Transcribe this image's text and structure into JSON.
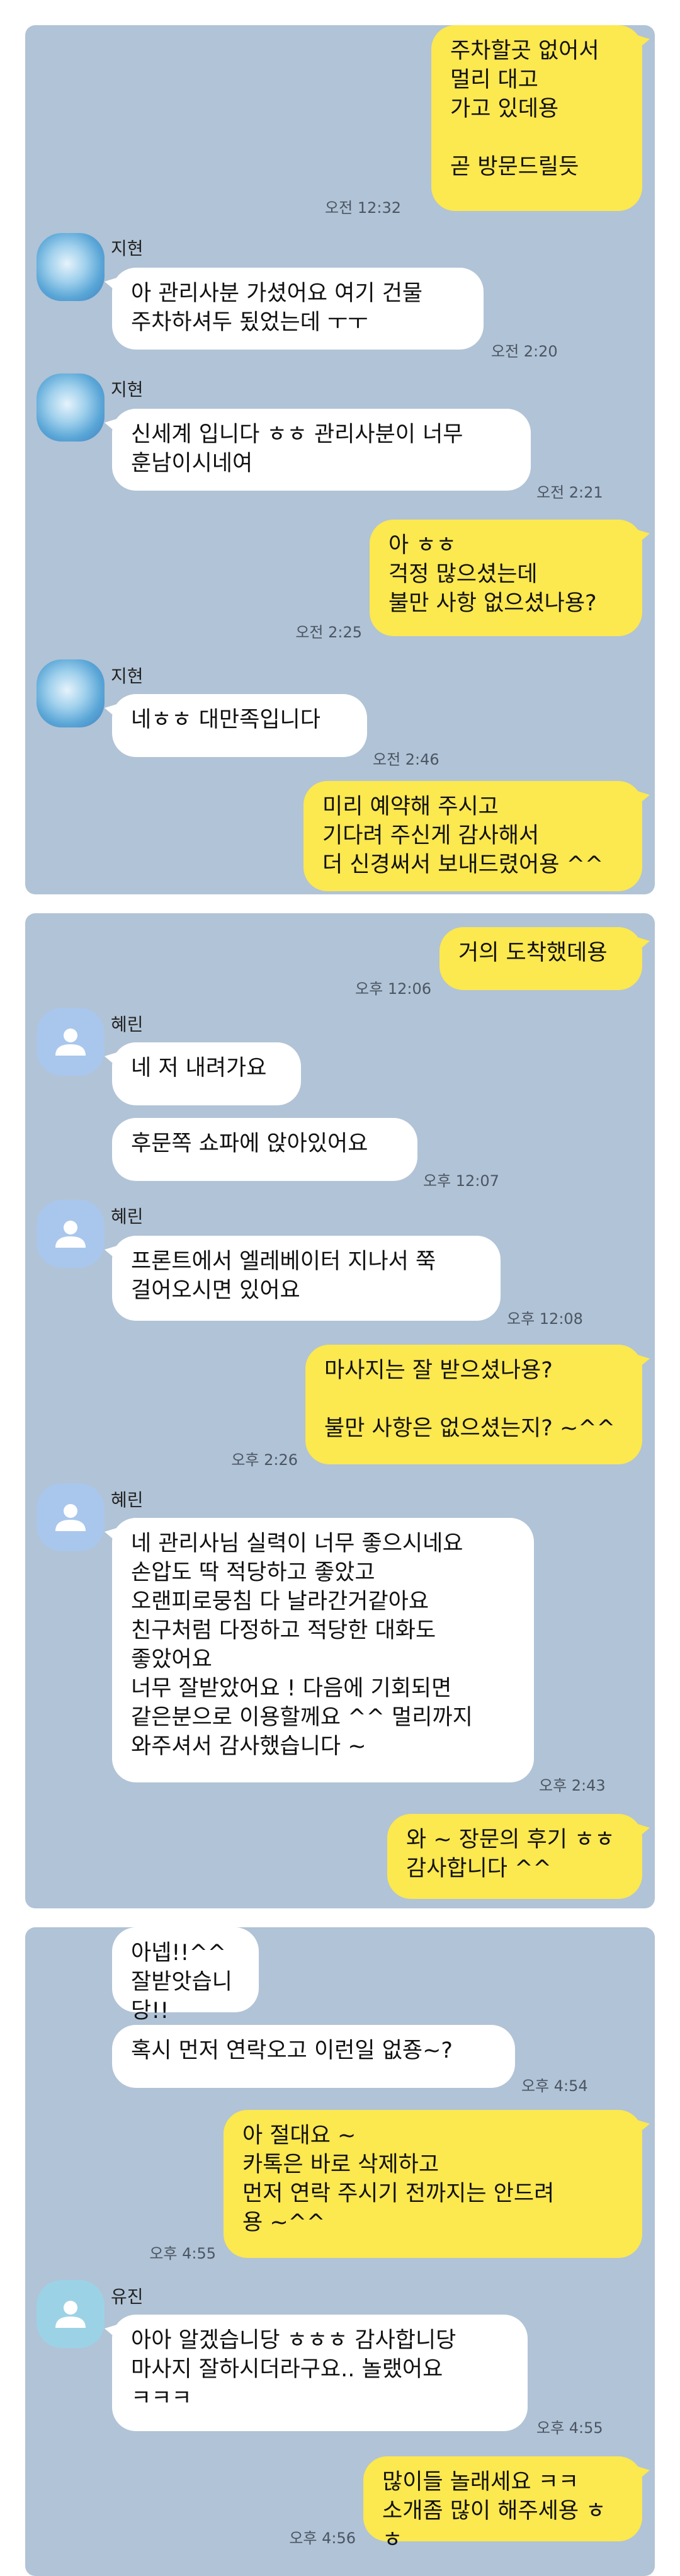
{
  "panel1": {
    "m1": {
      "text": "주차할곳 없어서\n멀리 대고\n가고 있데용\n\n곧 방문드릴듯",
      "time": "오전 12:32"
    },
    "m2": {
      "sender": "지현",
      "text": "아 관리사분 가셨어요 여기 건물\n주차하셔두 됬었는데 ㅜㅜ",
      "time": "오전 2:20"
    },
    "m3": {
      "sender": "지현",
      "text": "신세계 입니다 ㅎㅎ 관리사분이 너무\n훈남이시네여",
      "time": "오전 2:21"
    },
    "m4": {
      "text": "아 ㅎㅎ\n걱정 많으셨는데\n불만 사항 없으셨나용?",
      "time": "오전 2:25"
    },
    "m5": {
      "sender": "지현",
      "text": "네ㅎㅎ 대만족입니다",
      "time": "오전 2:46"
    },
    "m6": {
      "text": "미리 예약해 주시고\n기다려 주신게 감사해서\n더 신경써서 보내드렸어용 ^^"
    }
  },
  "panel2": {
    "m1": {
      "text": "거의 도착했데용",
      "time": "오후 12:06"
    },
    "m2": {
      "sender": "혜린",
      "text": "네 저 내려가요"
    },
    "m3": {
      "text": "후문쪽 쇼파에 앉아있어요",
      "time": "오후 12:07"
    },
    "m4": {
      "sender": "혜린",
      "text": "프론트에서 엘레베이터 지나서 쭉\n걸어오시면 있어요",
      "time": "오후 12:08"
    },
    "m5": {
      "text": "마사지는 잘 받으셨나용?\n\n불만 사항은 없으셨는지? ~^^",
      "time": "오후 2:26"
    },
    "m6": {
      "sender": "혜린",
      "text": "네 관리사님 실력이 너무 좋으시네요\n손압도 딱 적당하고 좋았고\n오랜피로뭉침 다 날라간거같아요\n친구처럼 다정하고 적당한 대화도\n좋았어요\n너무 잘받았어요 ! 다음에 기회되면\n같은분으로 이용할께요 ^^ 멀리까지\n와주셔서 감사했습니다 ~",
      "time": "오후 2:43"
    },
    "m7": {
      "text": "와 ~ 장문의 후기 ㅎㅎ\n감사합니다 ^^"
    }
  },
  "panel3": {
    "m1": {
      "text": "아넵!!^^\n잘받앗습니당!!"
    },
    "m2": {
      "text": "혹시 먼저 연락오고 이런일 없죵~?",
      "time": "오후 4:54"
    },
    "m3": {
      "text": "아 절대요 ~\n카톡은 바로 삭제하고\n먼저 연락 주시기 전까지는 안드려\n용 ~^^",
      "time": "오후 4:55"
    },
    "m4": {
      "sender": "유진",
      "text": "아아 알겠습니당 ㅎㅎㅎ 감사합니당\n마사지 잘하시더라구요.. 놀랬어요\nㅋㅋㅋ",
      "time": "오후 4:55"
    },
    "m5": {
      "text": "많이들 놀래세요 ㅋㅋ\n소개좀 많이 해주세용 ㅎㅎ",
      "time": "오후 4:56"
    }
  },
  "colors": {
    "chat_background": "#b1c3d6",
    "my_bubble": "#fce84f",
    "their_bubble": "#ffffff"
  }
}
